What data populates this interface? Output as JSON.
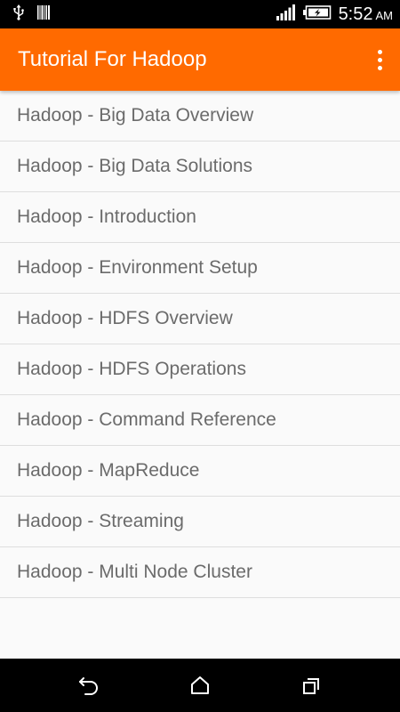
{
  "status_bar": {
    "time": "5:52",
    "ampm": "AM",
    "icons": [
      "usb-icon",
      "barcode-icon",
      "signal-icon",
      "battery-charging-icon"
    ]
  },
  "app_bar": {
    "title": "Tutorial For Hadoop",
    "menu_icon": "overflow-menu-icon",
    "color": "#ff6a00"
  },
  "list": {
    "items": [
      "Hadoop - Big Data Overview",
      "Hadoop - Big Data Solutions",
      "Hadoop - Introduction",
      "Hadoop - Environment Setup",
      "Hadoop - HDFS Overview",
      "Hadoop - HDFS Operations",
      "Hadoop - Command Reference",
      "Hadoop - MapReduce",
      "Hadoop - Streaming",
      "Hadoop - Multi Node Cluster"
    ]
  },
  "nav_bar": {
    "icons": [
      "back-icon",
      "home-icon",
      "recents-icon"
    ]
  }
}
